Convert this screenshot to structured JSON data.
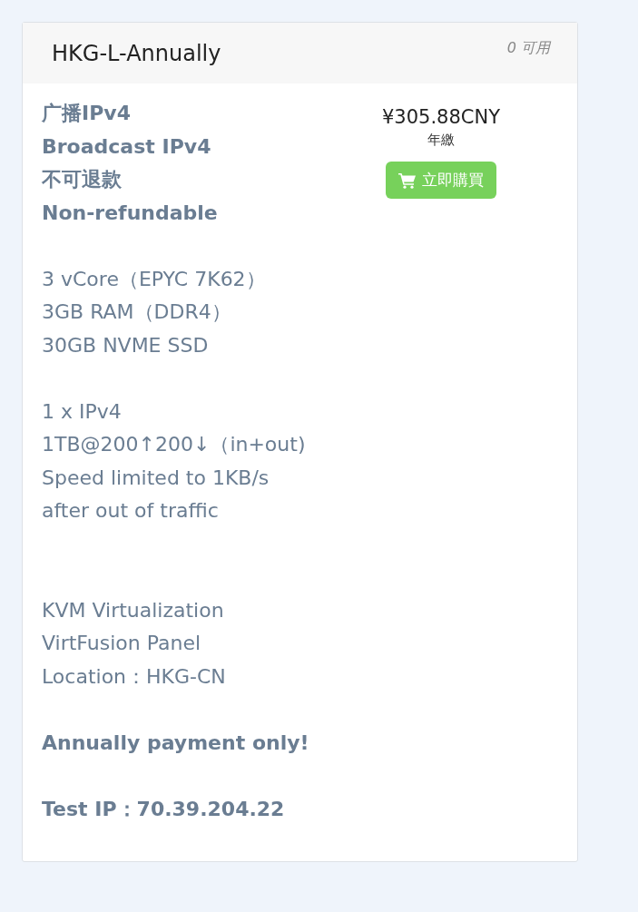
{
  "card": {
    "title": "HKG-L-Annually",
    "availability": "0 可用",
    "lines": [
      {
        "kind": "bold",
        "text": "广播IPv4"
      },
      {
        "kind": "bold",
        "text": "Broadcast IPv4"
      },
      {
        "kind": "bold",
        "text": "不可退款"
      },
      {
        "kind": "bold",
        "text": "Non-refundable"
      },
      {
        "kind": "gap"
      },
      {
        "kind": "normal",
        "text": "3 vCore（EPYC 7K62）"
      },
      {
        "kind": "normal",
        "text": "3GB RAM（DDR4）"
      },
      {
        "kind": "normal",
        "text": "30GB NVME SSD"
      },
      {
        "kind": "gap"
      },
      {
        "kind": "normal",
        "text": "1 x IPv4"
      },
      {
        "kind": "normal",
        "text": "1TB@200↑200↓（in+out)"
      },
      {
        "kind": "normal",
        "text": "Speed limited to 1KB/s"
      },
      {
        "kind": "normal",
        "text": "after out of traffic"
      },
      {
        "kind": "gap"
      },
      {
        "kind": "gap"
      },
      {
        "kind": "normal",
        "text": "KVM Virtualization"
      },
      {
        "kind": "normal",
        "text": "VirtFusion Panel"
      },
      {
        "kind": "normal",
        "text": "Location：HKG-CN"
      },
      {
        "kind": "gap"
      },
      {
        "kind": "bold",
        "text": "Annually payment only!"
      },
      {
        "kind": "gap"
      },
      {
        "kind": "bold",
        "text": "Test IP：70.39.204.22"
      }
    ],
    "price": "¥305.88CNY",
    "cycle": "年繳",
    "buy_button": "立即購買"
  }
}
